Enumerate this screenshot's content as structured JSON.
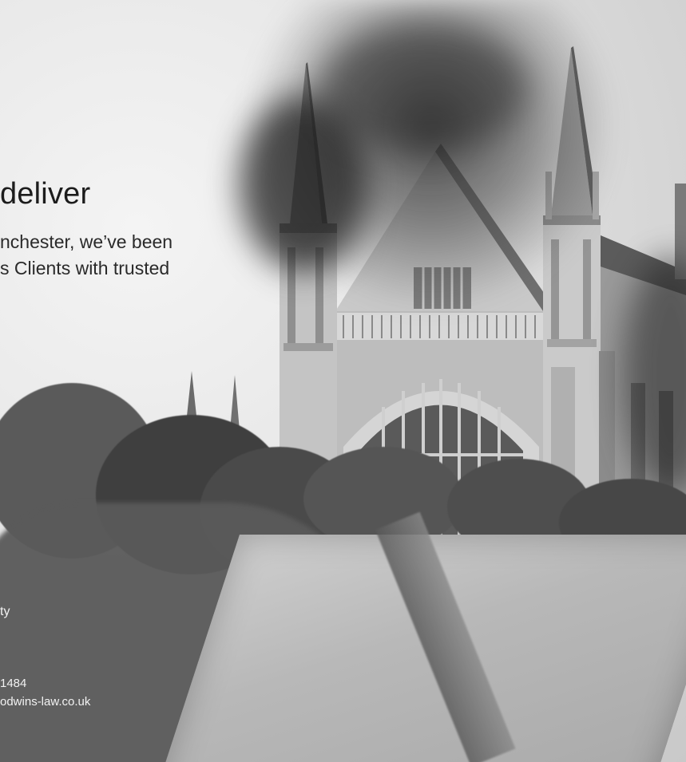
{
  "headline": "deliver",
  "intro": {
    "line1": "nchester, we’ve been",
    "line2": "s Clients with trusted"
  },
  "side_text": "ty",
  "contact": {
    "phone_fragment": "1484",
    "email_fragment": "odwins-law.co.uk"
  },
  "colors": {
    "headline": "#1c1c1c",
    "footer_text": "#f2f2f2"
  },
  "image": {
    "subject": "cathedral-west-front-photo",
    "style": "black-and-white"
  }
}
